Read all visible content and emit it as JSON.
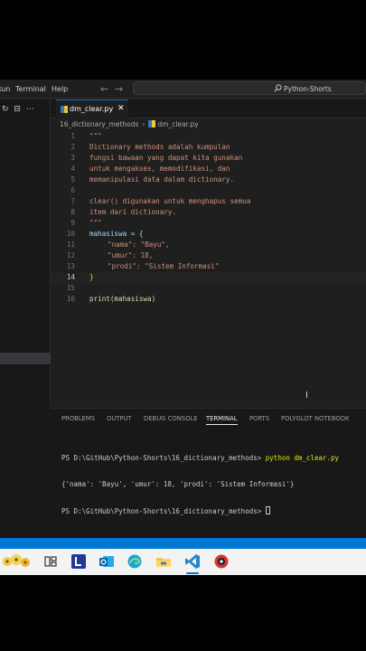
{
  "menu": {
    "items": [
      "Run",
      "Terminal",
      "Help"
    ]
  },
  "command_center": {
    "text": "Python-Shorts"
  },
  "tab": {
    "label": "dm_clear.py",
    "close": "✕"
  },
  "breadcrumb": {
    "folder": "16_dictionary_methods",
    "file": "dm_clear.py",
    "separator": "›"
  },
  "editor": {
    "lines": [
      {
        "n": "1",
        "t": "\"\"\""
      },
      {
        "n": "2",
        "t": "Dictionary methods adalah kumpulan"
      },
      {
        "n": "3",
        "t": "fungsi bawaan yang dapat kita gunakan"
      },
      {
        "n": "4",
        "t": "untuk mengakses, memodifikasi, dan"
      },
      {
        "n": "5",
        "t": "memanipulasi data dalam dictionary."
      },
      {
        "n": "6",
        "t": ""
      },
      {
        "n": "7",
        "t": "clear() digunakan untuk menghapus semua"
      },
      {
        "n": "8",
        "t": "item dari dictionary."
      },
      {
        "n": "9",
        "t": "\"\"\""
      },
      {
        "n": "10",
        "t": "mahasiswa = {"
      },
      {
        "n": "11",
        "t": "\"nama\": \"Bayu\","
      },
      {
        "n": "12",
        "t": "\"umur\": 18,"
      },
      {
        "n": "13",
        "t": "\"prodi\": \"Sistem Informasi\""
      },
      {
        "n": "14",
        "t": "}"
      },
      {
        "n": "15",
        "t": ""
      },
      {
        "n": "16",
        "t": "print(mahasiswa)"
      }
    ]
  },
  "panel": {
    "tabs": [
      "PROBLEMS",
      "OUTPUT",
      "DEBUG CONSOLE",
      "TERMINAL",
      "PORTS",
      "POLYGLOT NOTEBOOK"
    ],
    "active_tab": "TERMINAL"
  },
  "terminal": {
    "prompt": "PS D:\\GitHub\\Python-Shorts\\16_dictionary_methods>",
    "command": "python dm_clear.py",
    "output": "{'nama': 'Bayu', 'umur': 18, 'prodi': 'Sistem Informasi'}"
  },
  "taskbar": {
    "icons": [
      "flower-widget-icon",
      "task-view-icon",
      "l-app-icon",
      "outlook-icon",
      "edge-icon",
      "file-explorer-icon",
      "vscode-icon",
      "record-app-icon"
    ]
  },
  "colors": {
    "accent": "#0078d4",
    "editor_bg": "#1f1f1f",
    "string": "#ce9178",
    "keyword_var": "#9cdcfe"
  }
}
